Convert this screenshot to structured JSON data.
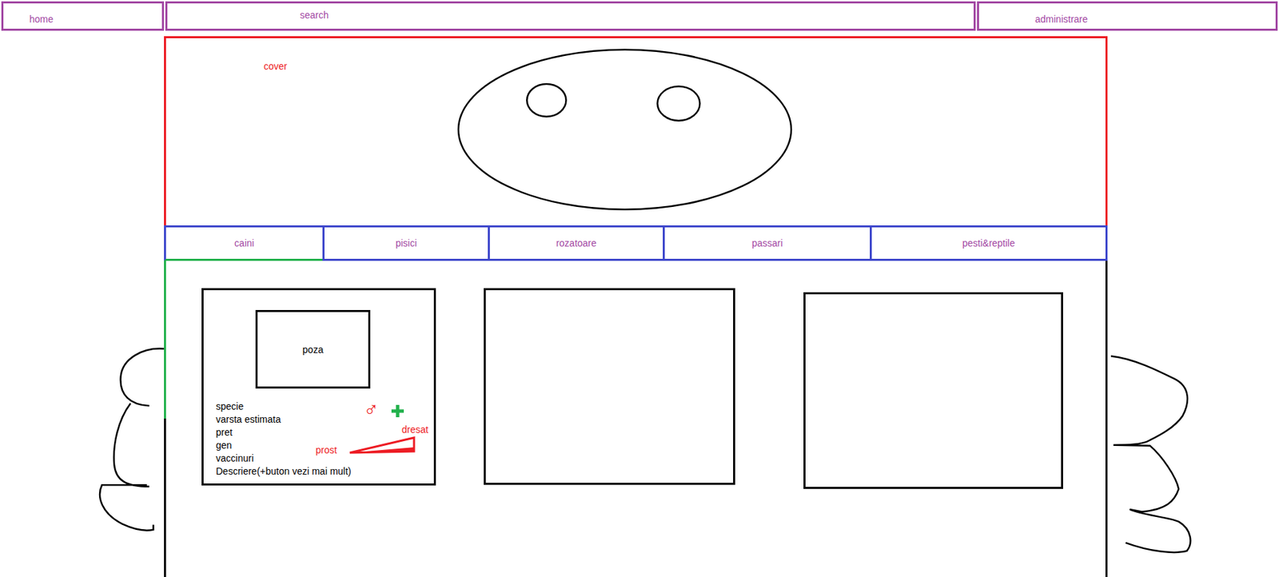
{
  "nav": [
    {
      "label": "home"
    },
    {
      "label": "search"
    },
    {
      "label": "administrare"
    }
  ],
  "cover": {
    "label": "cover"
  },
  "categories": [
    {
      "label": "caini",
      "selected": true
    },
    {
      "label": "pisici",
      "selected": false
    },
    {
      "label": "rozatoare",
      "selected": false
    },
    {
      "label": "passari",
      "selected": false
    },
    {
      "label": "pesti&reptile",
      "selected": false
    }
  ],
  "cards": [
    {
      "kind": "detailed",
      "photo": "poza",
      "fields": [
        "specie",
        "varsta estimata",
        "pret",
        "gen",
        "vaccinuri",
        "Descriere(+buton vezi mai mult)"
      ],
      "gender": "♂",
      "training": {
        "low": "prost",
        "high": "dresat"
      }
    },
    {
      "kind": "empty"
    },
    {
      "kind": "empty"
    }
  ]
}
